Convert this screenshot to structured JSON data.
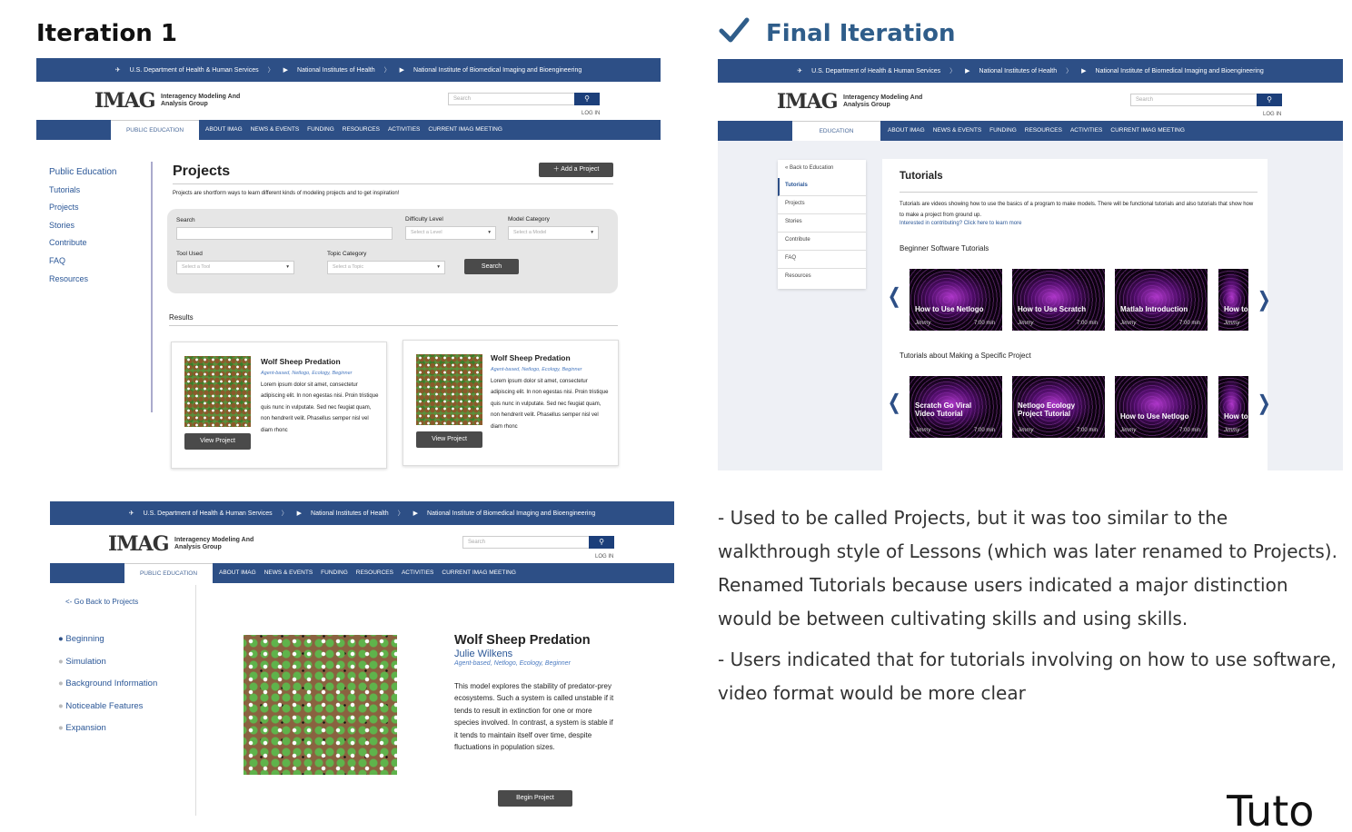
{
  "headings": {
    "iteration1": "Iteration 1",
    "final": "Final Iteration"
  },
  "icons": {
    "check": "check-icon",
    "search": "search-icon",
    "plus": "plus-icon",
    "chevron_left": "chevron-left-icon",
    "chevron_right": "chevron-right-icon",
    "caret_down": "caret-down-icon",
    "gov_bird": "hhs-eagle-icon",
    "gov_flag": "flag-icon"
  },
  "colors": {
    "navy": "#2d4f86",
    "heading_blue": "#2f5d8a",
    "link_blue": "#2b5797",
    "button_dark": "#4a4a4a"
  },
  "gov": {
    "hhs": "U.S. Department of Health & Human Services",
    "nih": "National Institutes of Health",
    "nibib": "National Institute of Biomedical Imaging and Bioengineering"
  },
  "site": {
    "logo": "IMAG",
    "logo_sub1": "Interagency Modeling And",
    "logo_sub2": "Analysis Group",
    "search_placeholder": "Search",
    "login": "LOG IN"
  },
  "nav": {
    "public_education": "PUBLIC EDUCATION",
    "education": "EDUCATION",
    "items": [
      "ABOUT IMAG",
      "NEWS & EVENTS",
      "FUNDING",
      "RESOURCES",
      "ACTIVITIES",
      "CURRENT IMAG MEETING"
    ]
  },
  "projects_page": {
    "sidebar": [
      "Public Education",
      "Tutorials",
      "Projects",
      "Stories",
      "Contribute",
      "FAQ",
      "Resources"
    ],
    "title": "Projects",
    "add_button": "Add a Project",
    "intro": "Projects are shortform ways to learn different kinds of modeling projects and to get inspiration!",
    "filters": {
      "search_label": "Search",
      "difficulty_label": "Difficulty Level",
      "difficulty_placeholder": "Select a Level",
      "model_label": "Model Category",
      "model_placeholder": "Select a Model",
      "tool_label": "Tool Used",
      "tool_placeholder": "Select a Tool",
      "topic_label": "Topic Category",
      "topic_placeholder": "Select a Topic",
      "search_button": "Search"
    },
    "results_label": "Results",
    "cards": [
      {
        "title": "Wolf Sheep Predation",
        "tags": "Agent-based, Netlogo, Ecology, Beginner",
        "body": "Lorem ipsum dolor sit amet, consectetur adipiscing elit. In non egestas nisi. Proin tristique quis nunc in vulputate. Sed nec feugiat quam, non hendrerit velit. Phasellus semper nisl vel diam rhonc",
        "button": "View Project"
      },
      {
        "title": "Wolf Sheep Predation",
        "tags": "Agent-based, Netlogo, Ecology, Beginner",
        "body": "Lorem ipsum dolor sit amet, consectetur adipiscing elit. In non egestas nisi. Proin tristique quis nunc in vulputate. Sed nec feugiat quam, non hendrerit velit. Phasellus semper nisl vel diam rhonc",
        "button": "View Project"
      }
    ]
  },
  "tutorials_page": {
    "sidebar": [
      "« Back to Education",
      "Tutorials",
      "Projects",
      "Stories",
      "Contribute",
      "FAQ",
      "Resources"
    ],
    "title": "Tutorials",
    "intro": "Tutorials are videos showing how to use the basics of a program to make models. There will be functional tutorials and also tutorials that show how to make a project from ground up.",
    "contribute_link": "Interested in contributing? Click here to learn more",
    "section1": "Beginner Software Tutorials",
    "section2": "Tutorials about Making a Specific Project",
    "row1": [
      {
        "title": "How to Use Netlogo",
        "author": "Jimmy",
        "duration": "7:00 min"
      },
      {
        "title": "How to Use Scratch",
        "author": "Jimmy",
        "duration": "7:00 min"
      },
      {
        "title": "Matlab Introduction",
        "author": "Jimmy",
        "duration": "7:00 min"
      },
      {
        "title": "How to",
        "author": "Jimmy",
        "duration": ""
      }
    ],
    "row2": [
      {
        "title": "Scratch Go Viral Video Tutorial",
        "author": "Jimmy",
        "duration": "7:00 min"
      },
      {
        "title": "Netlogo Ecology Project Tutorial",
        "author": "Jimmy",
        "duration": "7:00 min"
      },
      {
        "title": "How to Use Netlogo",
        "author": "Jimmy",
        "duration": "7:00 min"
      },
      {
        "title": "How to",
        "author": "Jimmy",
        "duration": ""
      }
    ]
  },
  "project_detail": {
    "back": "<- Go Back to Projects",
    "steps": [
      "Beginning",
      "Simulation",
      "Background Information",
      "Noticeable Features",
      "Expansion"
    ],
    "title": "Wolf Sheep Predation",
    "author": "Julie Wilkens",
    "tags": "Agent-based, Netlogo, Ecology, Beginner",
    "description": "This model explores the stability of predator-prey ecosystems. Such a system is called unstable if it tends to result in extinction for one or more species involved. In contrast, a system is stable if it tends to maintain itself over time, despite fluctuations in population sizes.",
    "button": "Begin Project"
  },
  "notes": [
    "- Used to be called Projects, but it was too similar to the walkthrough style of Lessons (which was later renamed to Projects). Renamed Tutorials because users indicated a major distinction would be between cultivating skills and using skills.",
    "- Users indicated that for tutorials involving on how to use software, video format would be more clear"
  ],
  "cutoff_text": "Tuto"
}
